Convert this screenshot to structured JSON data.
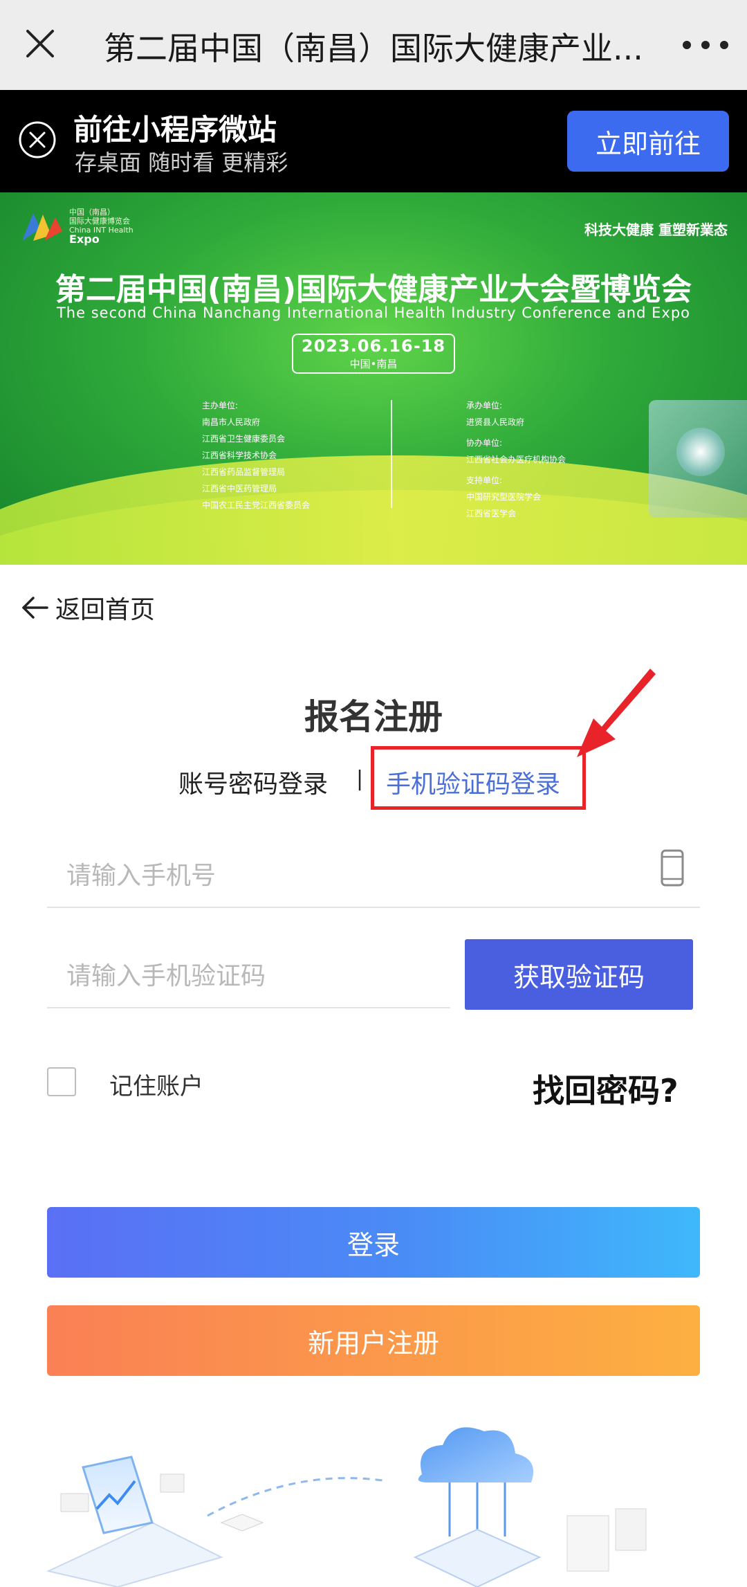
{
  "topbar": {
    "title": "第二届中国（南昌）国际大健康产业..."
  },
  "promo": {
    "title": "前往小程序微站",
    "subtitle": "存桌面 随时看 更精彩",
    "button": "立即前往"
  },
  "banner": {
    "logo_lines": [
      "中国（南昌）",
      "国际大健康博览会",
      "China INT Health"
    ],
    "logo_expo": "Expo",
    "slogan": "科技大健康 重塑新業态",
    "title": "第二届中国(南昌)国际大健康产业大会暨博览会",
    "subtitle": "The second China Nanchang International Health Industry Conference and Expo",
    "date": "2023.06.16-18",
    "location": "中国•南昌",
    "organizers": {
      "host_label": "主办单位:",
      "hosts": [
        "南昌市人民政府",
        "江西省卫生健康委员会",
        "江西省科学技术协会",
        "江西省药品监督管理局",
        "江西省中医药管理局",
        "中国农工民主党江西省委员会"
      ],
      "undertaker_label": "承办单位:",
      "undertaker": "进贤县人民政府",
      "co_label": "协办单位:",
      "co": "江西省社会办医疗机构协会",
      "support_label": "支持单位:",
      "support": [
        "中国研究型医院学会",
        "江西省医学会"
      ]
    }
  },
  "back": {
    "label": "返回首页"
  },
  "form": {
    "heading": "报名注册",
    "tab_password": "账号密码登录",
    "tab_separator": "|",
    "tab_sms": "手机验证码登录",
    "phone_placeholder": "请输入手机号",
    "code_placeholder": "请输入手机验证码",
    "get_code": "获取验证码",
    "remember": "记住账户",
    "forgot": "找回密码?",
    "login": "登录",
    "register": "新用户注册"
  },
  "colors": {
    "accent_blue": "#4a5fe0",
    "link_blue": "#4a6fd7",
    "highlight_red": "#e8232a"
  }
}
